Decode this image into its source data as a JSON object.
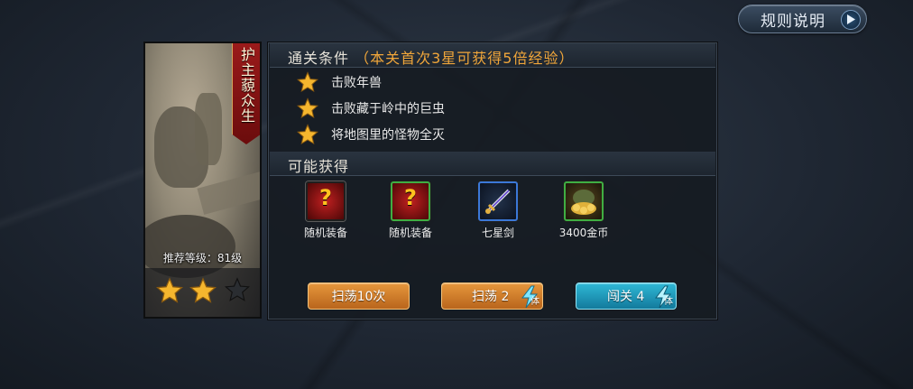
{
  "rules_button": {
    "label": "规则说明",
    "icon": "play-arrow-icon"
  },
  "stage": {
    "name": "护主藐众生",
    "recommended_level": "推荐等级：81级",
    "stars_earned": 2,
    "stars_total": 3
  },
  "clear_conditions": {
    "header": "通关条件",
    "note": "（本关首次3星可获得5倍经验）",
    "items": [
      {
        "text": "击败年兽",
        "icon": "gold-star-icon"
      },
      {
        "text": "击败藏于岭中的巨虫",
        "icon": "gold-star-icon"
      },
      {
        "text": "将地图里的怪物全灭",
        "icon": "gold-star-icon"
      }
    ]
  },
  "rewards": {
    "header": "可能获得",
    "items": [
      {
        "name": "随机装备",
        "icon": "random-equipment-icon",
        "frame": "gray"
      },
      {
        "name": "随机装备",
        "icon": "random-equipment-icon",
        "frame": "green"
      },
      {
        "name": "七星剑",
        "icon": "seven-star-sword-icon",
        "frame": "blue"
      },
      {
        "name": "3400金币",
        "icon": "gold-coins-icon",
        "frame": "green"
      }
    ]
  },
  "actions": {
    "sweep10": {
      "label": "扫荡10次"
    },
    "sweep": {
      "label": "扫荡 2",
      "cost_icon": "stamina-icon",
      "cost_label": "体"
    },
    "challenge": {
      "label": "闯关 4",
      "cost_icon": "stamina-icon",
      "cost_label": "体"
    }
  },
  "colors": {
    "accent_orange": "#f0a63a",
    "button_orange": "#d07e2a",
    "button_cyan": "#1f9cc0",
    "banner_red": "#8a1515"
  }
}
